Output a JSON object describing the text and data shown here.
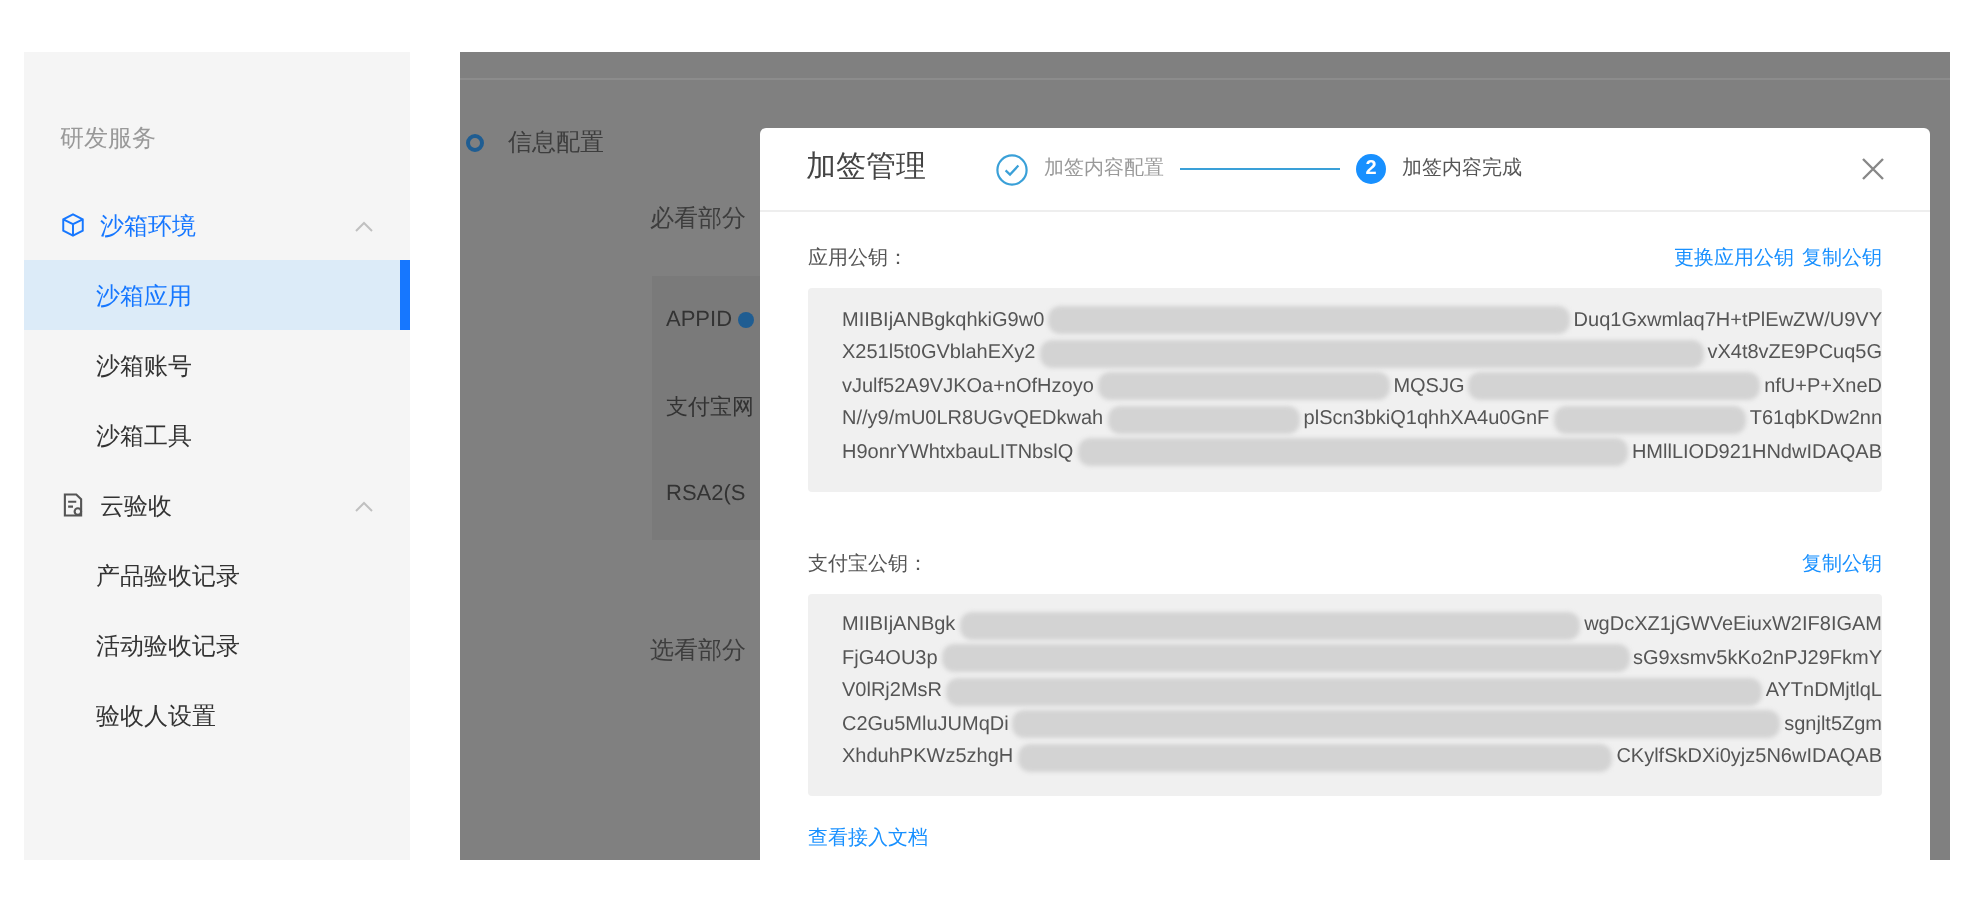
{
  "sidebar": {
    "title": "研发服务",
    "groups": [
      {
        "label": "沙箱环境",
        "kind": "cube",
        "selected": true,
        "expanded": true,
        "children": [
          {
            "label": "沙箱应用",
            "selected": true
          },
          {
            "label": "沙箱账号",
            "selected": false
          },
          {
            "label": "沙箱工具",
            "selected": false
          }
        ]
      },
      {
        "label": "云验收",
        "kind": "document",
        "selected": false,
        "expanded": true,
        "children": [
          {
            "label": "产品验收记录",
            "selected": false
          },
          {
            "label": "活动验收记录",
            "selected": false
          },
          {
            "label": "验收人设置",
            "selected": false
          }
        ]
      }
    ]
  },
  "background": {
    "step_label": "信息配置",
    "required_label": "必看部分",
    "fields": [
      "APPID",
      "支付宝网",
      "RSA2(S"
    ],
    "optional_label": "选看部分"
  },
  "dialog": {
    "title": "加签管理",
    "steps": [
      {
        "label": "加签内容配置",
        "kind": "done"
      },
      {
        "label": "加签内容完成",
        "kind": "current",
        "number": "2"
      }
    ],
    "sections": [
      {
        "label": "应用公钥：",
        "links": [
          "更换应用公钥",
          "复制公钥"
        ],
        "lines": [
          [
            "MIIBIjANBgkqhkiG9w0",
            "Duq1Gxwmlaq7H+tPlEwZW/U9VY"
          ],
          [
            "X251l5t0GVblahEXy2",
            "vX4t8vZE9PCuq5G"
          ],
          [
            "vJulf52A9VJKOa+nOfHzoyo",
            "MQSJG",
            "nfU+P+XneD"
          ],
          [
            "N//y9/mU0LR8UGvQEDkwah",
            "plScn3bkiQ1qhhXA4u0GnF",
            "T61qbKDw2nn"
          ],
          [
            "H9onrYWhtxbauLITNbslQ",
            "HMllLIOD921HNdwIDAQAB"
          ]
        ]
      },
      {
        "label": "支付宝公钥：",
        "links": [
          "复制公钥"
        ],
        "lines": [
          [
            "MIIBIjANBgk",
            "wgDcXZ1jGWVeEiuxW2IF8IGAM"
          ],
          [
            "FjG4OU3p",
            "sG9xsmv5kKo2nPJ29FkmY"
          ],
          [
            "V0lRj2MsR",
            "AYTnDMjtlqL"
          ],
          [
            "C2Gu5MluJUMqDi",
            "sgnjlt5Zgm"
          ],
          [
            "XhduhPKWz5zhgH",
            "CKylfSkDXi0yjz5N6wIDAQAB"
          ]
        ]
      }
    ],
    "doc_link": "查看接入文档"
  }
}
